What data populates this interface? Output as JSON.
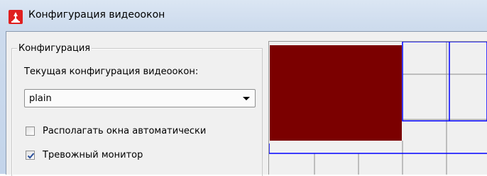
{
  "window": {
    "title": "Конфигурация видеоокон",
    "icon": "app-logo-icon",
    "accent_color": "#e02020"
  },
  "config_group": {
    "legend": "Конфигурация",
    "current_label": "Текущая конфигурация видеоокон:",
    "select": {
      "value": "plain"
    },
    "auto_arrange": {
      "label": "Располагать окна автоматически",
      "checked": false
    },
    "alarm_monitor": {
      "label": "Тревожный монитор",
      "checked": true
    }
  },
  "preview": {
    "selected_cell_color": "#7b0000",
    "outline_color": "#0000ff",
    "grid_color": "#8a8a8a"
  }
}
